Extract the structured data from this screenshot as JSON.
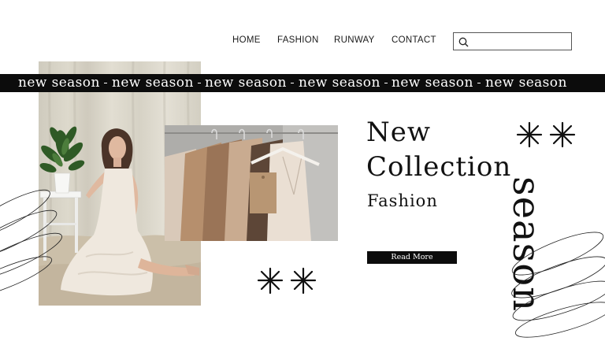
{
  "nav": {
    "items": [
      {
        "label": "HOME"
      },
      {
        "label": "FASHION"
      },
      {
        "label": "RUNWAY"
      },
      {
        "label": "CONTACT"
      }
    ],
    "search": {
      "placeholder": "",
      "icon": "search-icon"
    }
  },
  "banner": {
    "items": [
      "new season",
      "new season",
      "new season",
      "new season",
      "new season",
      "new season"
    ]
  },
  "hero": {
    "title_line1": "New",
    "title_line2": "Collection",
    "subtitle": "Fashion",
    "cta_label": "Read More",
    "vertical_word": "season"
  },
  "images": {
    "model_photo": "woman in cream dress seated beside plant on white stool",
    "clothes_photo": "neutral toned garments on hangers"
  },
  "colors": {
    "background": "#ffffff",
    "text": "#111111",
    "banner": "#0c0c0c"
  }
}
